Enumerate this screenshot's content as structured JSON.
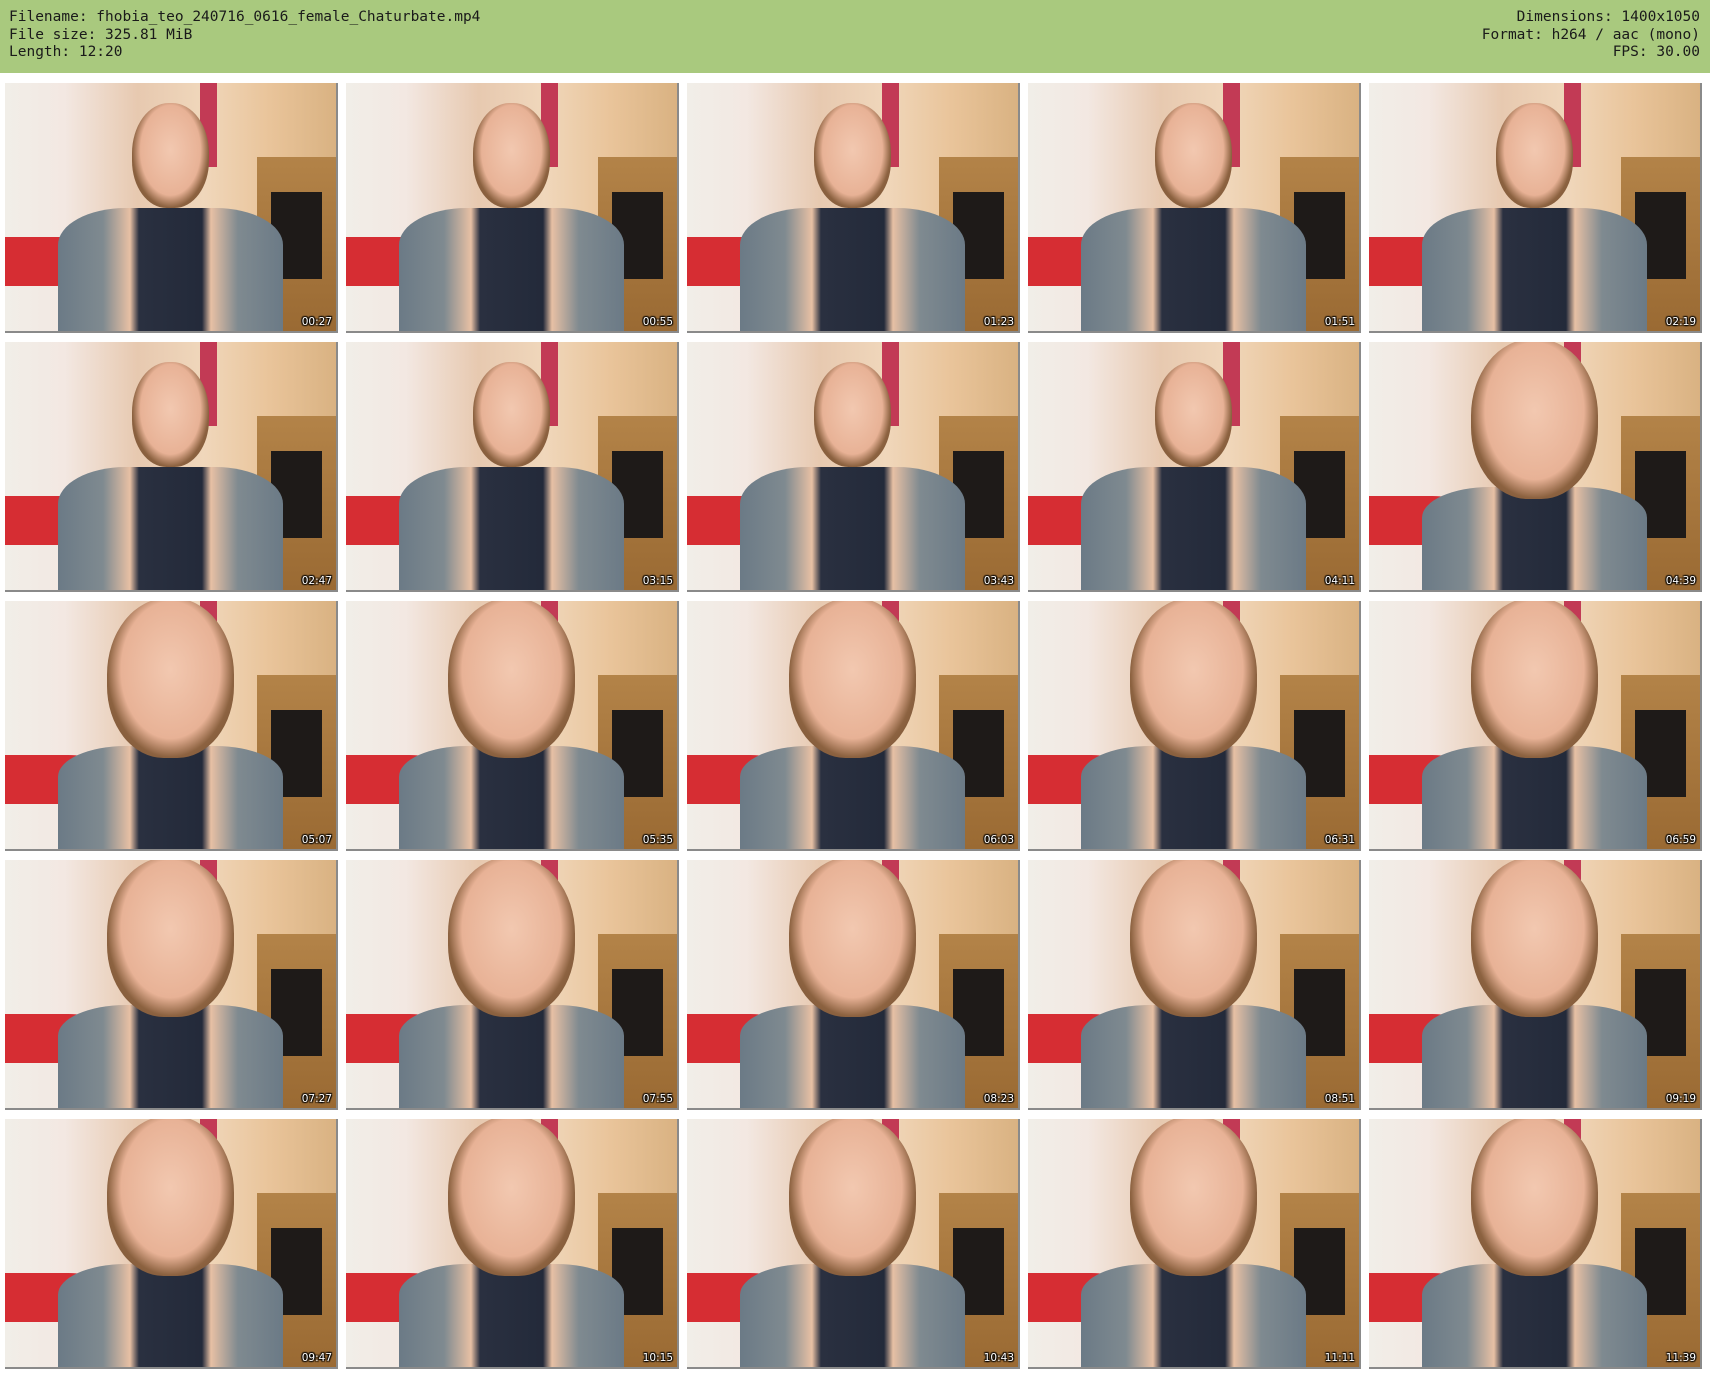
{
  "header": {
    "filename_line": "Filename: fhobia_teo_240716_0616_female_Chaturbate.mp4",
    "filesize_line": "File size: 325.81 MiB",
    "length_line": "Length: 12:20",
    "dimensions_line": "Dimensions: 1400x1050",
    "format_line": "Format: h264 / aac (mono)",
    "fps_line": "FPS: 30.00"
  },
  "thumbnails": [
    {
      "timestamp": "00:27",
      "framing": "wide"
    },
    {
      "timestamp": "00:55",
      "framing": "wide"
    },
    {
      "timestamp": "01:23",
      "framing": "wide"
    },
    {
      "timestamp": "01:51",
      "framing": "wide"
    },
    {
      "timestamp": "02:19",
      "framing": "wide"
    },
    {
      "timestamp": "02:47",
      "framing": "wide"
    },
    {
      "timestamp": "03:15",
      "framing": "wide"
    },
    {
      "timestamp": "03:43",
      "framing": "wide"
    },
    {
      "timestamp": "04:11",
      "framing": "wide"
    },
    {
      "timestamp": "04:39",
      "framing": "zoom"
    },
    {
      "timestamp": "05:07",
      "framing": "zoom"
    },
    {
      "timestamp": "05:35",
      "framing": "zoom"
    },
    {
      "timestamp": "06:03",
      "framing": "zoom"
    },
    {
      "timestamp": "06:31",
      "framing": "zoom"
    },
    {
      "timestamp": "06:59",
      "framing": "zoom"
    },
    {
      "timestamp": "07:27",
      "framing": "zoom"
    },
    {
      "timestamp": "07:55",
      "framing": "zoom"
    },
    {
      "timestamp": "08:23",
      "framing": "zoom"
    },
    {
      "timestamp": "08:51",
      "framing": "zoom"
    },
    {
      "timestamp": "09:19",
      "framing": "zoom"
    },
    {
      "timestamp": "09:47",
      "framing": "zoom"
    },
    {
      "timestamp": "10:15",
      "framing": "zoom"
    },
    {
      "timestamp": "10:43",
      "framing": "zoom"
    },
    {
      "timestamp": "11:11",
      "framing": "zoom"
    },
    {
      "timestamp": "11:39",
      "framing": "zoom"
    }
  ],
  "colors": {
    "header_background": "#a9c97e",
    "page_background": "#ffffff"
  }
}
